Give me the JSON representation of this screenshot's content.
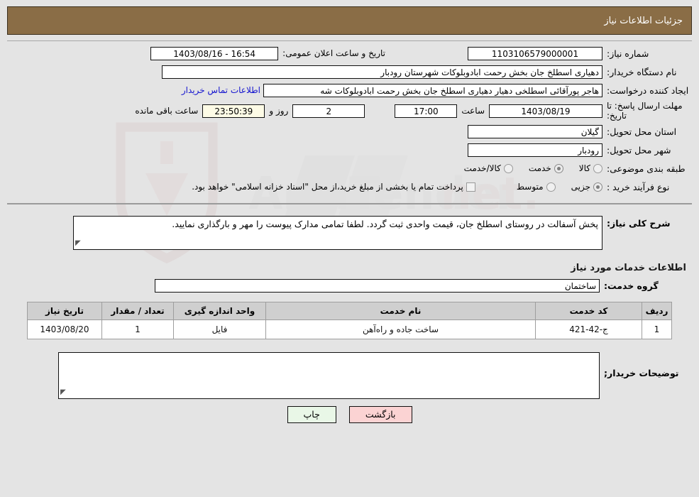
{
  "header": {
    "title": "جزئیات اطلاعات نیاز",
    "bar_color": "#8a6d46"
  },
  "info": {
    "need_number_label": "شماره نیاز:",
    "need_number_value": "1103106579000001",
    "public_announce_label": "تاریخ و ساعت اعلان عمومی:",
    "public_announce_value": "16:54 - 1403/08/16",
    "buyer_org_label": "نام دستگاه خریدار:",
    "buyer_org_value": "دهیاری اسطلخ جان بخش رحمت ابادوبلوکات شهرستان رودبار",
    "requester_label": "ایجاد کننده درخواست:",
    "requester_value": "هاجر پورآقائی اسطلخی دهیار دهیاری اسطلخ جان بخش رحمت ابادوبلوکات شه",
    "contact_link": "اطلاعات تماس خریدار",
    "deadline_label": "مهلت ارسال پاسخ: تا تاریخ:",
    "deadline_date": "1403/08/19",
    "hour_label": "ساعت",
    "deadline_time": "17:00",
    "days_value": "2",
    "days_label": "روز و",
    "countdown_value": "23:50:39",
    "remaining_label": "ساعت باقی مانده",
    "province_label": "استان محل تحویل:",
    "province_value": "گیلان",
    "city_label": "شهر محل تحویل:",
    "city_value": "رودبار",
    "category_label": "طبقه بندی موضوعی:",
    "category_options": [
      {
        "label": "کالا",
        "selected": false
      },
      {
        "label": "خدمت",
        "selected": true
      },
      {
        "label": "کالا/خدمت",
        "selected": false
      }
    ],
    "process_label": "نوع فرآیند خرید :",
    "process_options": [
      {
        "label": "جزیی",
        "selected": true
      },
      {
        "label": "متوسط",
        "selected": false
      }
    ],
    "treasury_checkbox_text": "پرداخت تمام یا بخشی از مبلغ خرید،از محل \"اسناد خزانه اسلامی\" خواهد بود.",
    "treasury_checked": false
  },
  "description": {
    "label": "شرح کلی نیاز:",
    "value": "پخش آسفالت در روستای اسطلخ جان، قیمت واحدی ثبت گردد. لطفا تمامی مدارک پیوست را مهر و بارگذاری نمایید."
  },
  "services": {
    "section_title": "اطلاعات خدمات مورد نیاز",
    "group_label": "گروه خدمت:",
    "group_value": "ساختمان",
    "table": {
      "columns": [
        "ردیف",
        "کد خدمت",
        "نام خدمت",
        "واحد اندازه گیری",
        "تعداد / مقدار",
        "تاریخ نیاز"
      ],
      "rows": [
        {
          "index": "1",
          "code": "ج-42-421",
          "name": "ساخت جاده و راه‌آهن",
          "unit": "فایل",
          "quantity": "1",
          "need_date": "1403/08/20"
        }
      ]
    }
  },
  "buyer_notes": {
    "label": "توضیحات خریدار;",
    "value": ""
  },
  "footer": {
    "print_label": "چاپ",
    "back_label": "بازگشت"
  },
  "watermark": {
    "text": "AriaTender.net"
  }
}
